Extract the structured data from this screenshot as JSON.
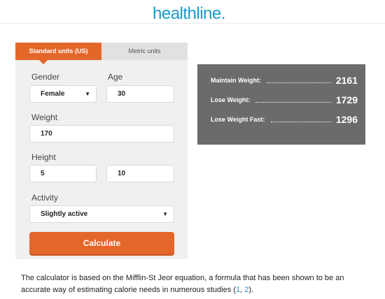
{
  "header": {
    "logo_text": "healthline",
    "logo_dot": "."
  },
  "tabs": [
    {
      "label": "Standard units (US)",
      "active": true
    },
    {
      "label": "Metric units",
      "active": false
    }
  ],
  "form": {
    "gender_label": "Gender",
    "gender_value": "Female",
    "age_label": "Age",
    "age_value": "30",
    "weight_label": "Weight",
    "weight_value": "170",
    "height_label": "Height",
    "height_feet": "5",
    "height_inches": "10",
    "activity_label": "Activity",
    "activity_value": "Slightly active",
    "calculate_label": "Calculate"
  },
  "results": [
    {
      "label": "Maintain Weight:",
      "value": "2161"
    },
    {
      "label": "Lose Weight:",
      "value": "1729"
    },
    {
      "label": "Lose Weight Fast:",
      "value": "1296"
    }
  ],
  "footnote": {
    "text_before": "The calculator is based on the Mifflin-St Jeor equation, a formula that has been shown to be an accurate way of estimating calorie needs in numerous studies (",
    "link1": "1",
    "separator": ", ",
    "link2": "2",
    "text_after": ")."
  },
  "colors": {
    "accent": "#e4672a",
    "brand": "#1a9bc7",
    "results_bg": "#6b6b6b",
    "panel_bg": "#f0f0f0"
  },
  "icons": {
    "dropdown": "caret-down-icon"
  }
}
